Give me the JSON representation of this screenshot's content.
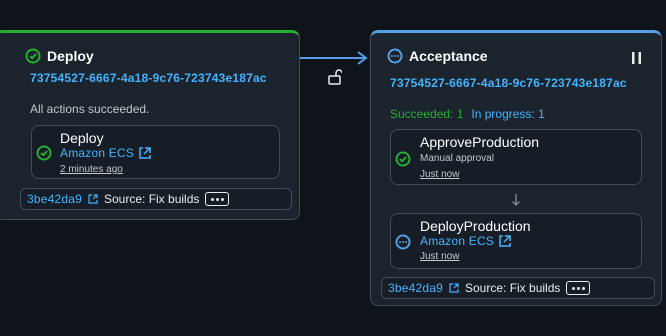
{
  "stages": [
    {
      "name": "Deploy",
      "status": "succeeded",
      "execution_id": "73754527-6667-4a18-9c76-723743e187ac",
      "summary": "All actions succeeded.",
      "actions": [
        {
          "title": "Deploy",
          "provider": "Amazon ECS",
          "time": "2 minutes ago",
          "status": "succeeded"
        }
      ],
      "footer": {
        "commit": "3be42da9",
        "source": "Source: Fix builds"
      }
    },
    {
      "name": "Acceptance",
      "status": "in-progress",
      "execution_id": "73754527-6667-4a18-9c76-723743e187ac",
      "counts": {
        "succeeded": "Succeeded: 1",
        "in_progress": "In progress: 1"
      },
      "actions": [
        {
          "title": "ApproveProduction",
          "subtitle": "Manual approval",
          "time": "Just now",
          "status": "succeeded"
        },
        {
          "title": "DeployProduction",
          "provider": "Amazon ECS",
          "time": "Just now",
          "status": "in-progress"
        }
      ],
      "footer": {
        "commit": "3be42da9",
        "source": "Source: Fix builds"
      }
    }
  ],
  "colors": {
    "success": "#29ad32",
    "info": "#539fe5",
    "link": "#42b4ff",
    "background": "#0f141a"
  },
  "icons": [
    "check-circle-icon",
    "in-progress-icon",
    "external-link-icon",
    "unlock-icon",
    "pause-icon",
    "arrow-down-icon",
    "arrow-right-icon"
  ]
}
